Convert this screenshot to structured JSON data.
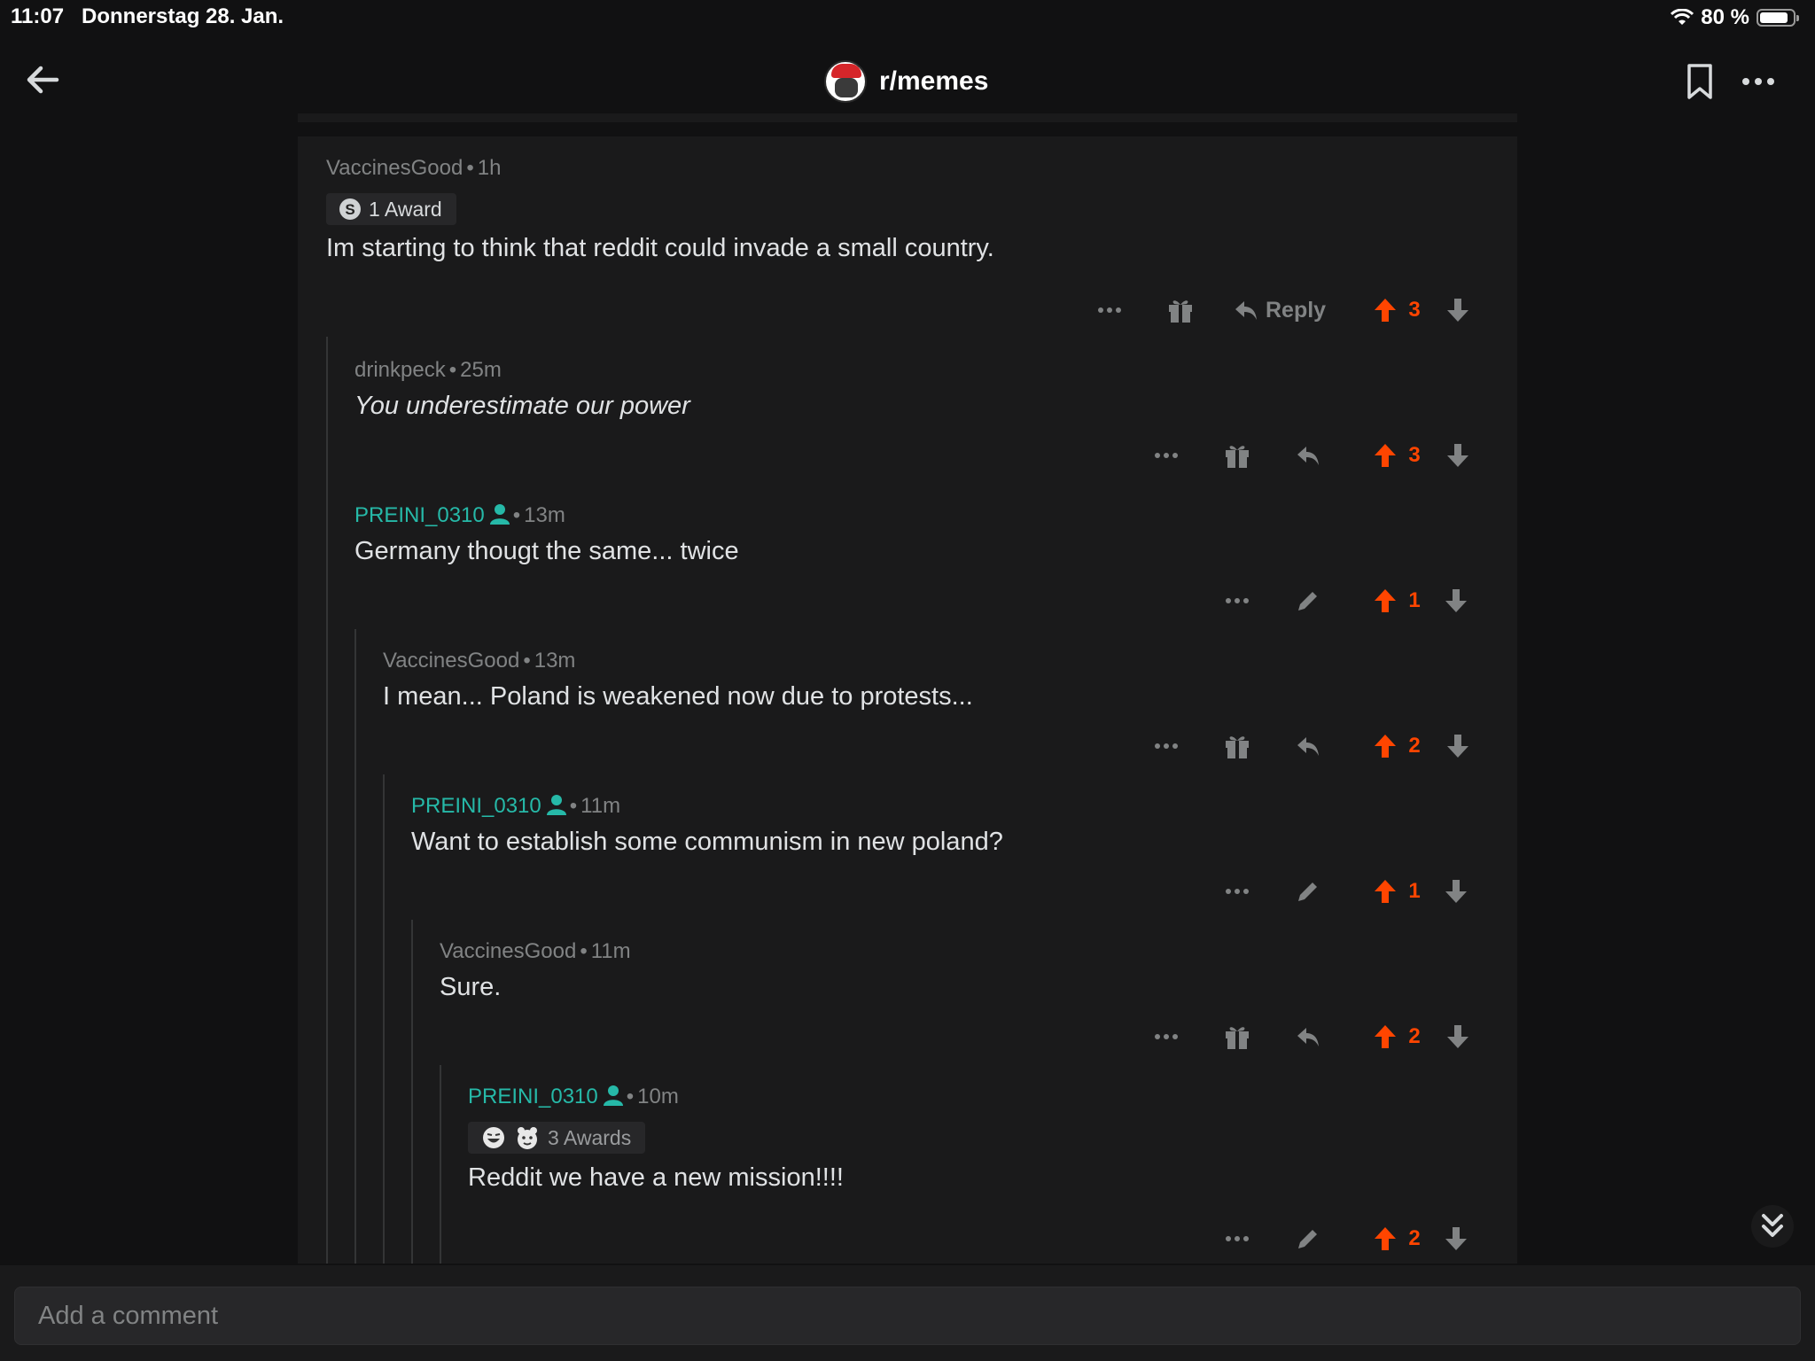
{
  "status_bar": {
    "time": "11:07",
    "date": "Donnerstag 28. Jan.",
    "battery": "80 %",
    "battery_level": 0.8
  },
  "header": {
    "subreddit": "r/memes",
    "icons": [
      "back-arrow-icon",
      "bookmark-icon",
      "more-icon"
    ]
  },
  "accent": {
    "upvote": "#ff4500",
    "op": "#26b9a8"
  },
  "comments": [
    {
      "author": "VaccinesGood",
      "time": "1h",
      "award": "1 Award",
      "body": "Im starting to think that reddit could invade a small country.",
      "reply_label": "Reply",
      "score": "3",
      "op": false
    },
    {
      "author": "drinkpeck",
      "time": "25m",
      "body": "You underestimate our power",
      "score": "3",
      "op": false
    },
    {
      "author": "PREINI_0310",
      "time": "13m",
      "body": "Germany thougt the same... twice",
      "score": "1",
      "op": true
    },
    {
      "author": "VaccinesGood",
      "time": "13m",
      "body": "I mean... Poland is weakened now due to protests...",
      "score": "2",
      "op": false
    },
    {
      "author": "PREINI_0310",
      "time": "11m",
      "body": "Want to establish some communism in new poland?",
      "score": "1",
      "op": true
    },
    {
      "author": "VaccinesGood",
      "time": "11m",
      "body": "Sure.",
      "score": "2",
      "op": false
    },
    {
      "author": "PREINI_0310",
      "time": "10m",
      "award": "3 Awards",
      "body": "Reddit we have a new mission!!!!",
      "score": "2",
      "op": true
    }
  ],
  "composer": {
    "placeholder": "Add a comment"
  }
}
